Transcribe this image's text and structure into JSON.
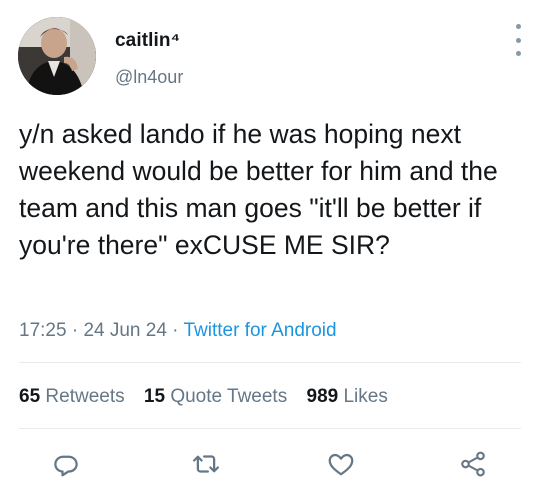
{
  "user": {
    "display_name": "caitlin⁴",
    "handle": "@ln4our"
  },
  "tweet": {
    "text": "y/n asked lando if he was hoping next weekend would be better for him and the team and this man goes \"it'll be better if you're there\" exCUSE ME SIR?",
    "time": "17:25",
    "separator_1": " · ",
    "date": "24 Jun 24",
    "separator_2": " · ",
    "source": "Twitter for Android"
  },
  "stats": {
    "retweets_count": "65",
    "retweets_label": "Retweets",
    "quotes_count": "15",
    "quotes_label": "Quote Tweets",
    "likes_count": "989",
    "likes_label": "Likes"
  },
  "icons": {
    "reply": "reply-icon",
    "retweet": "retweet-icon",
    "like": "heart-icon",
    "share": "share-icon",
    "more": "more-vertical-icon"
  },
  "colors": {
    "text": "#14171a",
    "secondary": "#657786",
    "link": "#1b95e0",
    "icon": "#657786",
    "divider": "#e6ecf0"
  }
}
